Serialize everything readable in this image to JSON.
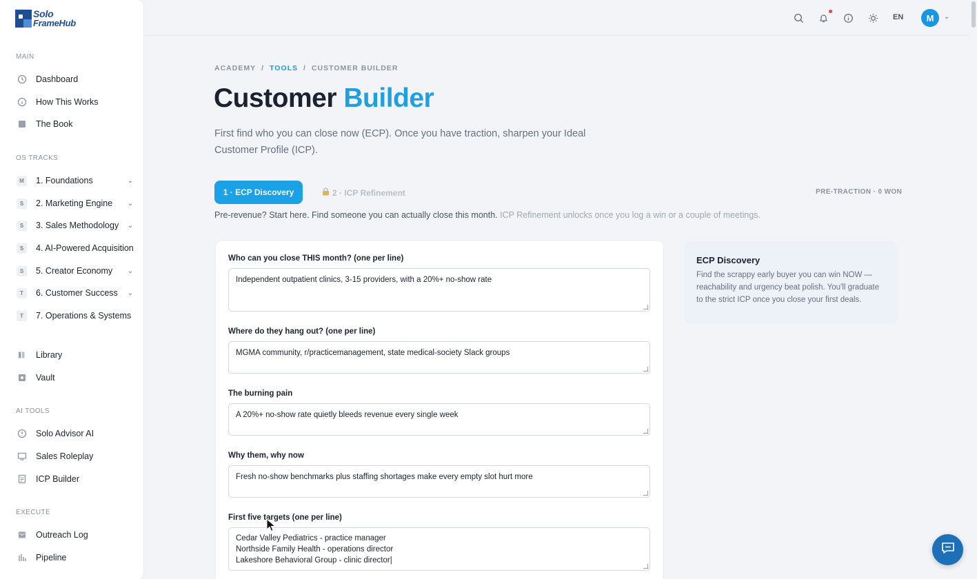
{
  "app": {
    "logo_line1": "Solo",
    "logo_line2": "FrameHub"
  },
  "sidebar": {
    "main_label": "MAIN",
    "main_items": [
      {
        "label": "Dashboard",
        "icon": "clock-icon"
      },
      {
        "label": "How This Works",
        "icon": "info-icon"
      },
      {
        "label": "The Book",
        "icon": "book-icon"
      }
    ],
    "tracks_label": "OS TRACKS",
    "tracks": [
      {
        "badge": "M",
        "label": "1. Foundations",
        "chevron": true
      },
      {
        "badge": "S",
        "label": "2. Marketing Engine",
        "chevron": true
      },
      {
        "badge": "S",
        "label": "3. Sales Methodology",
        "chevron": true
      },
      {
        "badge": "S",
        "label": "4. AI-Powered Acquisition",
        "chevron": false
      },
      {
        "badge": "S",
        "label": "5. Creator Economy",
        "chevron": true
      },
      {
        "badge": "T",
        "label": "6. Customer Success",
        "chevron": true
      },
      {
        "badge": "T",
        "label": "7. Operations & Systems",
        "chevron": false
      }
    ],
    "library_items": [
      {
        "label": "Library",
        "icon": "library-icon"
      },
      {
        "label": "Vault",
        "icon": "vault-icon"
      }
    ],
    "ai_label": "AI TOOLS",
    "ai_items": [
      {
        "label": "Solo Advisor AI",
        "icon": "advisor-icon"
      },
      {
        "label": "Sales Roleplay",
        "icon": "monitor-icon"
      },
      {
        "label": "ICP Builder",
        "icon": "document-icon"
      }
    ],
    "execute_label": "EXECUTE",
    "execute_items": [
      {
        "label": "Outreach Log",
        "icon": "mail-icon"
      },
      {
        "label": "Pipeline",
        "icon": "pipeline-icon"
      }
    ]
  },
  "topbar": {
    "language": "EN",
    "avatar_initial": "M"
  },
  "breadcrumb": {
    "root": "ACADEMY",
    "sep": "/",
    "tools": "TOOLS",
    "current": "CUSTOMER BUILDER"
  },
  "page": {
    "title_main": "Customer",
    "title_accent": "Builder",
    "subtitle": "First find who you can close now (ECP). Once you have traction, sharpen your Ideal Customer Profile (ICP).",
    "tab_active": "1 · ECP Discovery",
    "tab_locked": "2 · ICP Refinement",
    "status": "PRE-TRACTION · 0 WON",
    "hint_main": "Pre-revenue? Start here. Find someone you can actually close this month.",
    "hint_muted": "ICP Refinement unlocks once you log a win or a couple of meetings."
  },
  "form": {
    "fields": [
      {
        "label": "Who can you close THIS month? (one per line)",
        "value": "Independent outpatient clinics, 3-15 providers, with a 20%+ no-show rate"
      },
      {
        "label": "Where do they hang out? (one per line)",
        "value": "MGMA community, r/practicemanagement, state medical-society Slack groups"
      },
      {
        "label": "The burning pain",
        "value": "A 20%+ no-show rate quietly bleeds revenue every single week"
      },
      {
        "label": "Why them, why now",
        "value": "Fresh no-show benchmarks plus staffing shortages make every empty slot hurt more"
      },
      {
        "label": "First five targets (one per line)",
        "value": "Cedar Valley Pediatrics - practice manager\nNorthside Family Health - operations director\nLakeshore Behavioral Group - clinic director|"
      }
    ]
  },
  "side_card": {
    "title": "ECP Discovery",
    "body": "Find the scrappy early buyer you can win NOW — reachability and urgency beat polish. You'll graduate to the strict ICP once you close your first deals."
  },
  "colors": {
    "accent": "#1aa1e6",
    "brand": "#1e4d96",
    "chat": "#1d6fb8"
  }
}
